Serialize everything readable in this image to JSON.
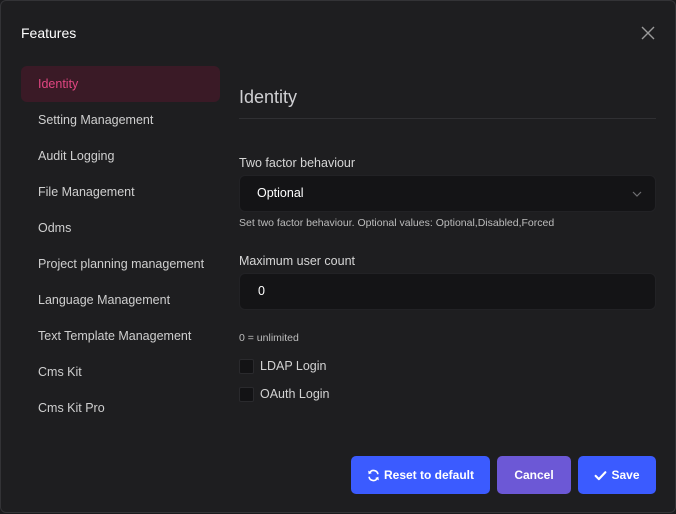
{
  "modal": {
    "title": "Features"
  },
  "sidebar": {
    "items": [
      {
        "label": "Identity",
        "active": true
      },
      {
        "label": "Setting Management"
      },
      {
        "label": "Audit Logging"
      },
      {
        "label": "File Management"
      },
      {
        "label": "Odms"
      },
      {
        "label": "Project planning management"
      },
      {
        "label": "Language Management"
      },
      {
        "label": "Text Template Management"
      },
      {
        "label": "Cms Kit"
      },
      {
        "label": "Cms Kit Pro"
      }
    ]
  },
  "main": {
    "section_title": "Identity",
    "two_factor": {
      "label": "Two factor behaviour",
      "value": "Optional",
      "help": "Set two factor behaviour. Optional values: Optional,Disabled,Forced"
    },
    "max_users": {
      "label": "Maximum user count",
      "value": "0",
      "help": "0 = unlimited"
    },
    "checkboxes": [
      {
        "label": "LDAP Login",
        "checked": false
      },
      {
        "label": "OAuth Login",
        "checked": false
      }
    ]
  },
  "footer": {
    "reset_label": "Reset to default",
    "cancel_label": "Cancel",
    "save_label": "Save"
  },
  "icons": {
    "close": "close-icon",
    "chevron": "chevron-down-icon",
    "reset": "refresh-icon",
    "save": "check-icon"
  },
  "colors": {
    "accent": "#3b5bff",
    "cancel": "#6c58d6",
    "active_text": "#e14682",
    "active_bg": "#3a1a26"
  }
}
